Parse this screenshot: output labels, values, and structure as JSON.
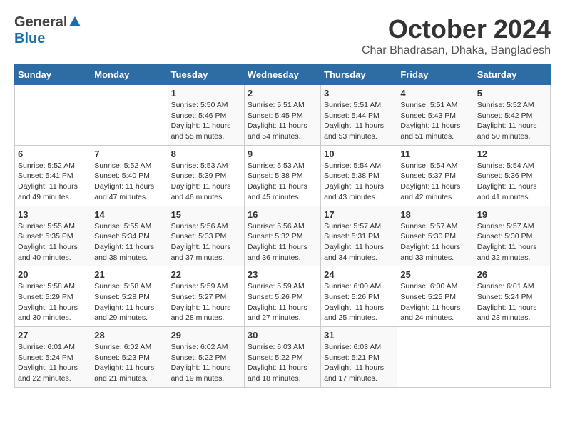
{
  "logo": {
    "general": "General",
    "blue": "Blue"
  },
  "title": "October 2024",
  "location": "Char Bhadrasan, Dhaka, Bangladesh",
  "days_of_week": [
    "Sunday",
    "Monday",
    "Tuesday",
    "Wednesday",
    "Thursday",
    "Friday",
    "Saturday"
  ],
  "weeks": [
    [
      {
        "day": "",
        "info": ""
      },
      {
        "day": "",
        "info": ""
      },
      {
        "day": "1",
        "info": "Sunrise: 5:50 AM\nSunset: 5:46 PM\nDaylight: 11 hours and 55 minutes."
      },
      {
        "day": "2",
        "info": "Sunrise: 5:51 AM\nSunset: 5:45 PM\nDaylight: 11 hours and 54 minutes."
      },
      {
        "day": "3",
        "info": "Sunrise: 5:51 AM\nSunset: 5:44 PM\nDaylight: 11 hours and 53 minutes."
      },
      {
        "day": "4",
        "info": "Sunrise: 5:51 AM\nSunset: 5:43 PM\nDaylight: 11 hours and 51 minutes."
      },
      {
        "day": "5",
        "info": "Sunrise: 5:52 AM\nSunset: 5:42 PM\nDaylight: 11 hours and 50 minutes."
      }
    ],
    [
      {
        "day": "6",
        "info": "Sunrise: 5:52 AM\nSunset: 5:41 PM\nDaylight: 11 hours and 49 minutes."
      },
      {
        "day": "7",
        "info": "Sunrise: 5:52 AM\nSunset: 5:40 PM\nDaylight: 11 hours and 47 minutes."
      },
      {
        "day": "8",
        "info": "Sunrise: 5:53 AM\nSunset: 5:39 PM\nDaylight: 11 hours and 46 minutes."
      },
      {
        "day": "9",
        "info": "Sunrise: 5:53 AM\nSunset: 5:38 PM\nDaylight: 11 hours and 45 minutes."
      },
      {
        "day": "10",
        "info": "Sunrise: 5:54 AM\nSunset: 5:38 PM\nDaylight: 11 hours and 43 minutes."
      },
      {
        "day": "11",
        "info": "Sunrise: 5:54 AM\nSunset: 5:37 PM\nDaylight: 11 hours and 42 minutes."
      },
      {
        "day": "12",
        "info": "Sunrise: 5:54 AM\nSunset: 5:36 PM\nDaylight: 11 hours and 41 minutes."
      }
    ],
    [
      {
        "day": "13",
        "info": "Sunrise: 5:55 AM\nSunset: 5:35 PM\nDaylight: 11 hours and 40 minutes."
      },
      {
        "day": "14",
        "info": "Sunrise: 5:55 AM\nSunset: 5:34 PM\nDaylight: 11 hours and 38 minutes."
      },
      {
        "day": "15",
        "info": "Sunrise: 5:56 AM\nSunset: 5:33 PM\nDaylight: 11 hours and 37 minutes."
      },
      {
        "day": "16",
        "info": "Sunrise: 5:56 AM\nSunset: 5:32 PM\nDaylight: 11 hours and 36 minutes."
      },
      {
        "day": "17",
        "info": "Sunrise: 5:57 AM\nSunset: 5:31 PM\nDaylight: 11 hours and 34 minutes."
      },
      {
        "day": "18",
        "info": "Sunrise: 5:57 AM\nSunset: 5:30 PM\nDaylight: 11 hours and 33 minutes."
      },
      {
        "day": "19",
        "info": "Sunrise: 5:57 AM\nSunset: 5:30 PM\nDaylight: 11 hours and 32 minutes."
      }
    ],
    [
      {
        "day": "20",
        "info": "Sunrise: 5:58 AM\nSunset: 5:29 PM\nDaylight: 11 hours and 30 minutes."
      },
      {
        "day": "21",
        "info": "Sunrise: 5:58 AM\nSunset: 5:28 PM\nDaylight: 11 hours and 29 minutes."
      },
      {
        "day": "22",
        "info": "Sunrise: 5:59 AM\nSunset: 5:27 PM\nDaylight: 11 hours and 28 minutes."
      },
      {
        "day": "23",
        "info": "Sunrise: 5:59 AM\nSunset: 5:26 PM\nDaylight: 11 hours and 27 minutes."
      },
      {
        "day": "24",
        "info": "Sunrise: 6:00 AM\nSunset: 5:26 PM\nDaylight: 11 hours and 25 minutes."
      },
      {
        "day": "25",
        "info": "Sunrise: 6:00 AM\nSunset: 5:25 PM\nDaylight: 11 hours and 24 minutes."
      },
      {
        "day": "26",
        "info": "Sunrise: 6:01 AM\nSunset: 5:24 PM\nDaylight: 11 hours and 23 minutes."
      }
    ],
    [
      {
        "day": "27",
        "info": "Sunrise: 6:01 AM\nSunset: 5:24 PM\nDaylight: 11 hours and 22 minutes."
      },
      {
        "day": "28",
        "info": "Sunrise: 6:02 AM\nSunset: 5:23 PM\nDaylight: 11 hours and 21 minutes."
      },
      {
        "day": "29",
        "info": "Sunrise: 6:02 AM\nSunset: 5:22 PM\nDaylight: 11 hours and 19 minutes."
      },
      {
        "day": "30",
        "info": "Sunrise: 6:03 AM\nSunset: 5:22 PM\nDaylight: 11 hours and 18 minutes."
      },
      {
        "day": "31",
        "info": "Sunrise: 6:03 AM\nSunset: 5:21 PM\nDaylight: 11 hours and 17 minutes."
      },
      {
        "day": "",
        "info": ""
      },
      {
        "day": "",
        "info": ""
      }
    ]
  ]
}
